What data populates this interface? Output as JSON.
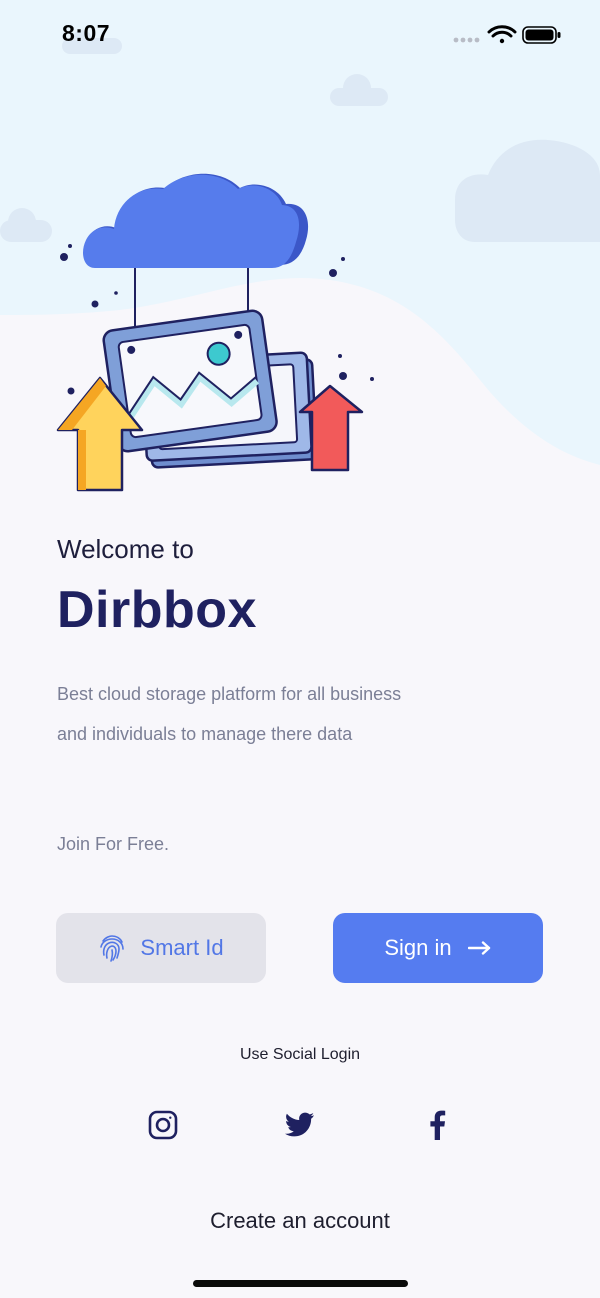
{
  "status_bar": {
    "time": "8:07"
  },
  "hero": {
    "welcome": "Welcome to",
    "app_name": "Dirbbox",
    "description": "Best cloud storage platform for all business and individuals to manage there data",
    "tagline": "Join For Free."
  },
  "actions": {
    "smart_id_label": "Smart Id",
    "sign_in_label": "Sign in"
  },
  "social": {
    "title": "Use Social Login",
    "providers": [
      "instagram-icon",
      "twitter-icon",
      "facebook-icon"
    ]
  },
  "footer": {
    "create_account_label": "Create an account"
  },
  "colors": {
    "primary": "#557cf0",
    "heading": "#1f2160",
    "muted_text": "#7b7f96",
    "sky": "#eaf6fd"
  }
}
